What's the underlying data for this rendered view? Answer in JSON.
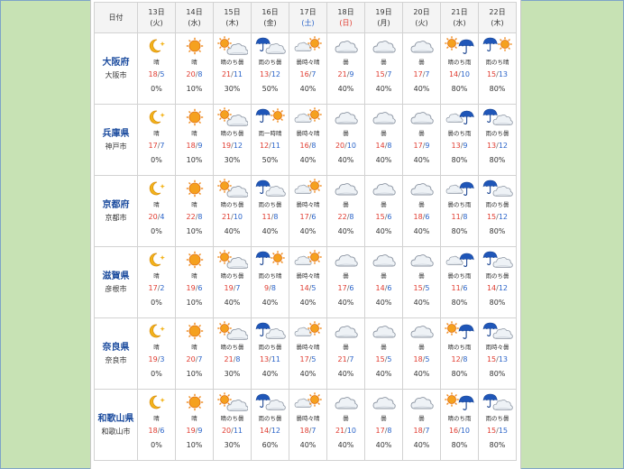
{
  "header": {
    "date_label": "日付",
    "days": [
      {
        "day": "13日",
        "wd": "(火)",
        "type": "weekday"
      },
      {
        "day": "14日",
        "wd": "(水)",
        "type": "weekday"
      },
      {
        "day": "15日",
        "wd": "(木)",
        "type": "weekday"
      },
      {
        "day": "16日",
        "wd": "(金)",
        "type": "weekday"
      },
      {
        "day": "17日",
        "wd": "(土)",
        "type": "sat"
      },
      {
        "day": "18日",
        "wd": "(日)",
        "type": "sun"
      },
      {
        "day": "19日",
        "wd": "(月)",
        "type": "weekday"
      },
      {
        "day": "20日",
        "wd": "(火)",
        "type": "weekday"
      },
      {
        "day": "21日",
        "wd": "(水)",
        "type": "weekday"
      },
      {
        "day": "22日",
        "wd": "(木)",
        "type": "weekday"
      }
    ]
  },
  "colors": {
    "high": "#e03a2e",
    "low": "#2a64c9",
    "pref": "#1b4b9e"
  },
  "rows": [
    {
      "pref": "大阪府",
      "city": "大阪市",
      "cells": [
        {
          "icon": "moon-icon",
          "text": "晴",
          "hi": "18",
          "lo": "5",
          "pop": "0%"
        },
        {
          "icon": "sun-icon",
          "text": "晴",
          "hi": "20",
          "lo": "8",
          "pop": "10%"
        },
        {
          "icon": "sun-cloud-icon",
          "text": "晴のち曇",
          "hi": "21",
          "lo": "11",
          "pop": "30%"
        },
        {
          "icon": "rain-cloud-icon",
          "text": "雨のち曇",
          "hi": "13",
          "lo": "12",
          "pop": "50%"
        },
        {
          "icon": "cloud-sun-icon",
          "text": "曇時々晴",
          "hi": "16",
          "lo": "7",
          "pop": "40%"
        },
        {
          "icon": "cloud-icon",
          "text": "曇",
          "hi": "21",
          "lo": "9",
          "pop": "40%"
        },
        {
          "icon": "cloud-icon",
          "text": "曇",
          "hi": "15",
          "lo": "7",
          "pop": "40%"
        },
        {
          "icon": "cloud-icon",
          "text": "曇",
          "hi": "17",
          "lo": "7",
          "pop": "40%"
        },
        {
          "icon": "sun-rain-icon",
          "text": "晴のち雨",
          "hi": "14",
          "lo": "10",
          "pop": "80%"
        },
        {
          "icon": "rain-sun-icon",
          "text": "雨のち晴",
          "hi": "15",
          "lo": "13",
          "pop": "80%"
        }
      ]
    },
    {
      "pref": "兵庫県",
      "city": "神戸市",
      "cells": [
        {
          "icon": "moon-icon",
          "text": "晴",
          "hi": "17",
          "lo": "7",
          "pop": "0%"
        },
        {
          "icon": "sun-icon",
          "text": "晴",
          "hi": "18",
          "lo": "9",
          "pop": "10%"
        },
        {
          "icon": "sun-cloud-icon",
          "text": "晴のち曇",
          "hi": "19",
          "lo": "12",
          "pop": "30%"
        },
        {
          "icon": "rain-sun-icon",
          "text": "雨一時晴",
          "hi": "12",
          "lo": "11",
          "pop": "50%"
        },
        {
          "icon": "cloud-sun-icon",
          "text": "曇時々晴",
          "hi": "16",
          "lo": "8",
          "pop": "40%"
        },
        {
          "icon": "cloud-icon",
          "text": "曇",
          "hi": "20",
          "lo": "10",
          "pop": "40%"
        },
        {
          "icon": "cloud-icon",
          "text": "曇",
          "hi": "14",
          "lo": "8",
          "pop": "40%"
        },
        {
          "icon": "cloud-icon",
          "text": "曇",
          "hi": "17",
          "lo": "9",
          "pop": "40%"
        },
        {
          "icon": "cloud-rain-icon",
          "text": "曇のち雨",
          "hi": "13",
          "lo": "9",
          "pop": "80%"
        },
        {
          "icon": "rain-cloud-icon",
          "text": "雨のち曇",
          "hi": "13",
          "lo": "12",
          "pop": "80%"
        }
      ]
    },
    {
      "pref": "京都府",
      "city": "京都市",
      "cells": [
        {
          "icon": "moon-icon",
          "text": "晴",
          "hi": "20",
          "lo": "4",
          "pop": "0%"
        },
        {
          "icon": "sun-icon",
          "text": "晴",
          "hi": "22",
          "lo": "8",
          "pop": "10%"
        },
        {
          "icon": "sun-cloud-icon",
          "text": "晴のち曇",
          "hi": "21",
          "lo": "10",
          "pop": "40%"
        },
        {
          "icon": "rain-cloud-icon",
          "text": "雨のち曇",
          "hi": "11",
          "lo": "8",
          "pop": "40%"
        },
        {
          "icon": "cloud-sun-icon",
          "text": "曇時々晴",
          "hi": "17",
          "lo": "6",
          "pop": "40%"
        },
        {
          "icon": "cloud-icon",
          "text": "曇",
          "hi": "22",
          "lo": "8",
          "pop": "40%"
        },
        {
          "icon": "cloud-icon",
          "text": "曇",
          "hi": "15",
          "lo": "6",
          "pop": "40%"
        },
        {
          "icon": "cloud-icon",
          "text": "曇",
          "hi": "18",
          "lo": "6",
          "pop": "40%"
        },
        {
          "icon": "cloud-rain-icon",
          "text": "曇のち雨",
          "hi": "11",
          "lo": "8",
          "pop": "80%"
        },
        {
          "icon": "rain-cloud-icon",
          "text": "雨のち曇",
          "hi": "15",
          "lo": "12",
          "pop": "80%"
        }
      ]
    },
    {
      "pref": "滋賀県",
      "city": "彦根市",
      "cells": [
        {
          "icon": "moon-icon",
          "text": "晴",
          "hi": "17",
          "lo": "2",
          "pop": "0%"
        },
        {
          "icon": "sun-icon",
          "text": "晴",
          "hi": "19",
          "lo": "6",
          "pop": "10%"
        },
        {
          "icon": "sun-cloud-icon",
          "text": "晴のち曇",
          "hi": "19",
          "lo": "7",
          "pop": "40%"
        },
        {
          "icon": "rain-sun-icon",
          "text": "雨のち晴",
          "hi": "9",
          "lo": "8",
          "pop": "40%"
        },
        {
          "icon": "cloud-sun-icon",
          "text": "曇時々晴",
          "hi": "14",
          "lo": "5",
          "pop": "40%"
        },
        {
          "icon": "cloud-icon",
          "text": "曇",
          "hi": "17",
          "lo": "6",
          "pop": "40%"
        },
        {
          "icon": "cloud-icon",
          "text": "曇",
          "hi": "14",
          "lo": "6",
          "pop": "40%"
        },
        {
          "icon": "cloud-icon",
          "text": "曇",
          "hi": "15",
          "lo": "5",
          "pop": "40%"
        },
        {
          "icon": "cloud-rain-icon",
          "text": "曇のち雨",
          "hi": "11",
          "lo": "6",
          "pop": "80%"
        },
        {
          "icon": "rain-cloud-icon",
          "text": "雨のち曇",
          "hi": "14",
          "lo": "12",
          "pop": "80%"
        }
      ]
    },
    {
      "pref": "奈良県",
      "city": "奈良市",
      "cells": [
        {
          "icon": "moon-icon",
          "text": "晴",
          "hi": "19",
          "lo": "3",
          "pop": "0%"
        },
        {
          "icon": "sun-icon",
          "text": "晴",
          "hi": "20",
          "lo": "7",
          "pop": "10%"
        },
        {
          "icon": "sun-cloud-icon",
          "text": "晴のち曇",
          "hi": "21",
          "lo": "8",
          "pop": "30%"
        },
        {
          "icon": "rain-cloud-icon",
          "text": "雨のち曇",
          "hi": "13",
          "lo": "11",
          "pop": "40%"
        },
        {
          "icon": "cloud-sun-icon",
          "text": "曇時々晴",
          "hi": "17",
          "lo": "5",
          "pop": "40%"
        },
        {
          "icon": "cloud-icon",
          "text": "曇",
          "hi": "21",
          "lo": "7",
          "pop": "40%"
        },
        {
          "icon": "cloud-icon",
          "text": "曇",
          "hi": "15",
          "lo": "5",
          "pop": "40%"
        },
        {
          "icon": "cloud-icon",
          "text": "曇",
          "hi": "18",
          "lo": "5",
          "pop": "40%"
        },
        {
          "icon": "sun-rain-icon",
          "text": "晴のち雨",
          "hi": "12",
          "lo": "8",
          "pop": "80%"
        },
        {
          "icon": "rain-cloud-icon",
          "text": "雨時々曇",
          "hi": "15",
          "lo": "13",
          "pop": "80%"
        }
      ]
    },
    {
      "pref": "和歌山県",
      "city": "和歌山市",
      "cells": [
        {
          "icon": "moon-icon",
          "text": "晴",
          "hi": "18",
          "lo": "6",
          "pop": "0%"
        },
        {
          "icon": "sun-icon",
          "text": "晴",
          "hi": "19",
          "lo": "9",
          "pop": "10%"
        },
        {
          "icon": "sun-cloud-icon",
          "text": "晴のち曇",
          "hi": "20",
          "lo": "11",
          "pop": "30%"
        },
        {
          "icon": "rain-cloud-icon",
          "text": "雨のち曇",
          "hi": "14",
          "lo": "12",
          "pop": "60%"
        },
        {
          "icon": "cloud-sun-icon",
          "text": "曇時々晴",
          "hi": "18",
          "lo": "7",
          "pop": "40%"
        },
        {
          "icon": "cloud-icon",
          "text": "曇",
          "hi": "21",
          "lo": "10",
          "pop": "40%"
        },
        {
          "icon": "cloud-icon",
          "text": "曇",
          "hi": "17",
          "lo": "8",
          "pop": "40%"
        },
        {
          "icon": "cloud-icon",
          "text": "曇",
          "hi": "18",
          "lo": "7",
          "pop": "40%"
        },
        {
          "icon": "sun-rain-icon",
          "text": "晴のち雨",
          "hi": "16",
          "lo": "10",
          "pop": "80%"
        },
        {
          "icon": "rain-cloud-icon",
          "text": "雨のち曇",
          "hi": "15",
          "lo": "15",
          "pop": "80%"
        }
      ]
    }
  ]
}
